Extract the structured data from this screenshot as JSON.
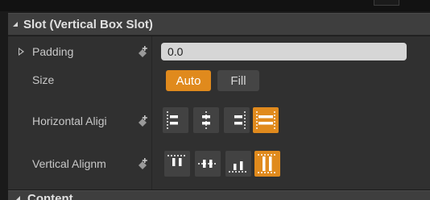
{
  "section": {
    "title": "Slot (Vertical Box Slot)",
    "next_title": "Content"
  },
  "rows": {
    "padding": {
      "label": "Padding",
      "value": "0.0"
    },
    "size": {
      "label": "Size",
      "options": [
        "Auto",
        "Fill"
      ],
      "selected": "Auto"
    },
    "horizontal_alignment": {
      "label": "Horizontal Aligi",
      "options": [
        "align-left-icon",
        "align-center-horizontal-icon",
        "align-right-icon",
        "fill-horizontal-icon"
      ],
      "selected": "fill-horizontal-icon"
    },
    "vertical_alignment": {
      "label": "Vertical Alignm",
      "options": [
        "align-top-icon",
        "align-center-vertical-icon",
        "align-bottom-icon",
        "fill-vertical-icon"
      ],
      "selected": "fill-vertical-icon"
    }
  },
  "colors": {
    "accent": "#e08a1d",
    "panel": "#303030",
    "header": "#3e3e3e",
    "input_bg": "#d6d6d6"
  }
}
